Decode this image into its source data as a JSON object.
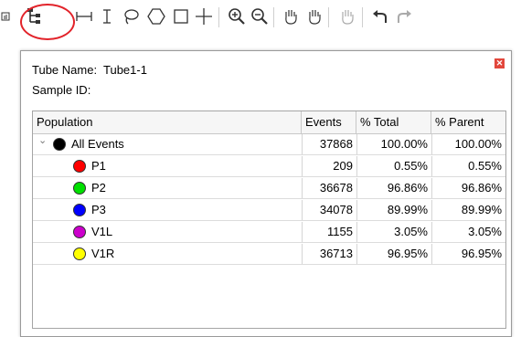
{
  "toolbar": {
    "icons": [
      "stats-icon",
      "hierarchy-icon",
      "range-gate-icon",
      "text-cursor-icon",
      "lasso-icon",
      "hexagon-icon",
      "rectangle-icon",
      "crosshair-icon",
      "zoom-in-icon",
      "zoom-out-icon",
      "pan-hand-icon",
      "grab-hand-icon",
      "hand-disabled-icon",
      "undo-icon",
      "redo-icon"
    ],
    "highlight_color": "#e2232a"
  },
  "panel": {
    "tube_name_label": "Tube Name:",
    "tube_name_value": "Tube1-1",
    "sample_id_label": "Sample ID:",
    "close_color": "#e2473c"
  },
  "table": {
    "headers": [
      "Population",
      "Events",
      "% Total",
      "% Parent"
    ],
    "rows": [
      {
        "name": "All Events",
        "color": "#000000",
        "events": "37868",
        "total": "100.00%",
        "parent": "100.00%"
      },
      {
        "name": "P1",
        "color": "#ff0000",
        "events": "209",
        "total": "0.55%",
        "parent": "0.55%"
      },
      {
        "name": "P2",
        "color": "#00e000",
        "events": "36678",
        "total": "96.86%",
        "parent": "96.86%"
      },
      {
        "name": "P3",
        "color": "#0000ff",
        "events": "34078",
        "total": "89.99%",
        "parent": "89.99%"
      },
      {
        "name": "V1L",
        "color": "#cc00cc",
        "events": "1155",
        "total": "3.05%",
        "parent": "3.05%"
      },
      {
        "name": "V1R",
        "color": "#ffff00",
        "events": "36713",
        "total": "96.95%",
        "parent": "96.95%"
      }
    ]
  }
}
